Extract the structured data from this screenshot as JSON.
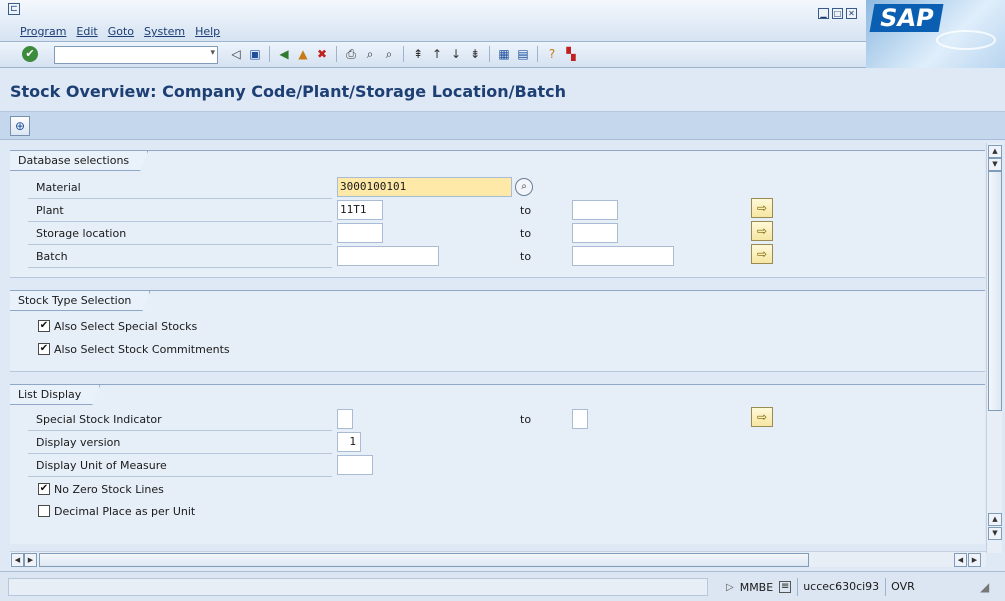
{
  "window": {
    "brand": "SAP"
  },
  "menubar": {
    "items": [
      "Program",
      "Edit",
      "Goto",
      "System",
      "Help"
    ]
  },
  "toolbar": {
    "command_value": ""
  },
  "title": "Stock Overview: Company Code/Plant/Storage Location/Batch",
  "groups": {
    "database": {
      "title": "Database selections",
      "material": {
        "label": "Material",
        "value": "3000100101"
      },
      "plant": {
        "label": "Plant",
        "value": "11T1",
        "to": "to",
        "to_value": ""
      },
      "storage": {
        "label": "Storage location",
        "value": "",
        "to": "to",
        "to_value": ""
      },
      "batch": {
        "label": "Batch",
        "value": "",
        "to": "to",
        "to_value": ""
      }
    },
    "stock_type": {
      "title": "Stock Type Selection",
      "special_stocks": {
        "label": "Also Select Special Stocks",
        "checked": true
      },
      "commitments": {
        "label": "Also Select Stock Commitments",
        "checked": true
      }
    },
    "list_display": {
      "title": "List Display",
      "special_indicator": {
        "label": "Special Stock Indicator",
        "value": "",
        "to": "to",
        "to_value": ""
      },
      "display_version": {
        "label": "Display version",
        "value": "1"
      },
      "display_uom": {
        "label": "Display Unit of Measure",
        "value": ""
      },
      "no_zero": {
        "label": "No Zero Stock Lines",
        "checked": true
      },
      "decimal": {
        "label": "Decimal Place as per Unit",
        "checked": false
      }
    }
  },
  "statusbar": {
    "transaction": "MMBE",
    "server": "uccec630ci93",
    "mode": "OVR"
  },
  "icons": {
    "check": "✔",
    "execute": "⊕",
    "more": "⇨",
    "checked_mark": "✔"
  }
}
